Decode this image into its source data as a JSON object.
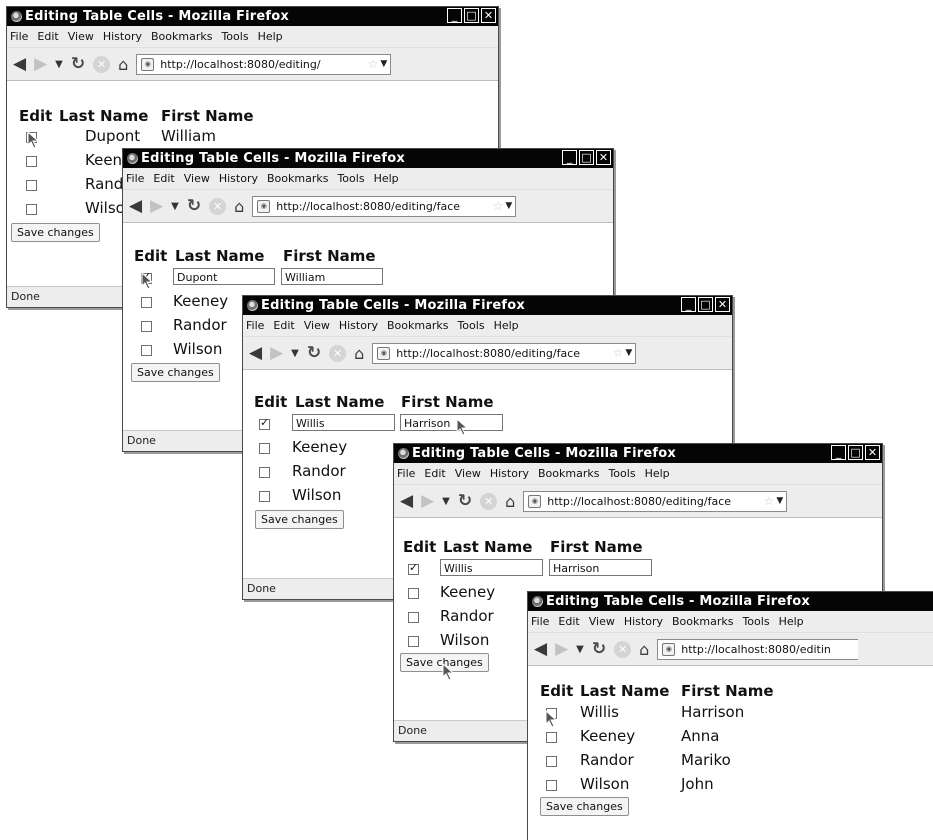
{
  "menu": [
    "File",
    "Edit",
    "View",
    "History",
    "Bookmarks",
    "Tools",
    "Help"
  ],
  "headers": {
    "edit": "Edit",
    "last": "Last Name",
    "first": "First Name"
  },
  "windows": [
    {
      "title": "Editing Table Cells - Mozilla Firefox",
      "url": "http://localhost:8080/editing/",
      "button": "Save changes",
      "status": "Done",
      "rows": [
        {
          "checked": false,
          "last": "Dupont",
          "first": "William"
        },
        {
          "checked": false,
          "last": "Keeney",
          "first": ""
        },
        {
          "checked": false,
          "last": "Randor",
          "first": ""
        },
        {
          "checked": false,
          "last": "Wilson",
          "first": ""
        }
      ]
    },
    {
      "title": "Editing Table Cells - Mozilla Firefox",
      "url": "http://localhost:8080/editing/face",
      "button": "Save changes",
      "status": "Done",
      "rows": [
        {
          "checked": true,
          "last": "Dupont",
          "first": "William",
          "editing": true
        },
        {
          "checked": false,
          "last": "Keeney",
          "first": ""
        },
        {
          "checked": false,
          "last": "Randor",
          "first": ""
        },
        {
          "checked": false,
          "last": "Wilson",
          "first": ""
        }
      ]
    },
    {
      "title": "Editing Table Cells - Mozilla Firefox",
      "url": "http://localhost:8080/editing/face",
      "button": "Save changes",
      "status": "Done",
      "rows": [
        {
          "checked": true,
          "last": "Willis",
          "first": "Harrison",
          "editing": true
        },
        {
          "checked": false,
          "last": "Keeney",
          "first": ""
        },
        {
          "checked": false,
          "last": "Randor",
          "first": ""
        },
        {
          "checked": false,
          "last": "Wilson",
          "first": ""
        }
      ]
    },
    {
      "title": "Editing Table Cells - Mozilla Firefox",
      "url": "http://localhost:8080/editing/face",
      "button": "Save changes",
      "status": "Done",
      "rows": [
        {
          "checked": true,
          "last": "Willis",
          "first": "Harrison",
          "editing": true
        },
        {
          "checked": false,
          "last": "Keeney",
          "first": ""
        },
        {
          "checked": false,
          "last": "Randor",
          "first": ""
        },
        {
          "checked": false,
          "last": "Wilson",
          "first": ""
        }
      ]
    },
    {
      "title": "Editing Table Cells - Mozilla Firefox",
      "url": "http://localhost:8080/editin",
      "button": "Save changes",
      "status": "",
      "rows": [
        {
          "checked": false,
          "last": "Willis",
          "first": "Harrison"
        },
        {
          "checked": false,
          "last": "Keeney",
          "first": "Anna"
        },
        {
          "checked": false,
          "last": "Randor",
          "first": "Mariko"
        },
        {
          "checked": false,
          "last": "Wilson",
          "first": "John"
        }
      ]
    }
  ]
}
